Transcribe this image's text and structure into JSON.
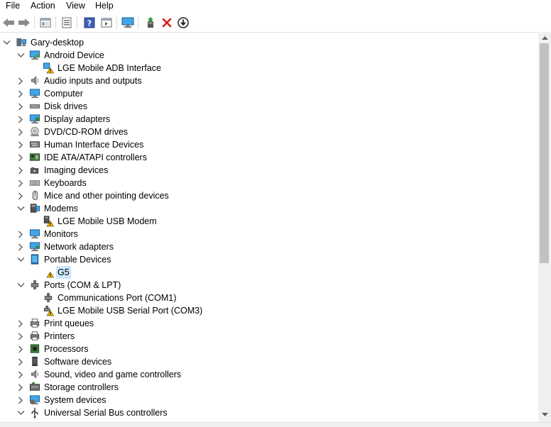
{
  "menu": [
    "File",
    "Action",
    "View",
    "Help"
  ],
  "toolbar": {
    "icons": [
      "back-arrow-icon",
      "forward-arrow-icon",
      "show-hide-tree-icon",
      "properties-icon",
      "help-icon",
      "action-pane-icon",
      "monitor-icon",
      "update-driver-icon",
      "uninstall-x-icon",
      "download-icon"
    ]
  },
  "tree": [
    {
      "label": "Gary-desktop",
      "level": 0,
      "state": "expanded",
      "icon": "computer-desktop-icon"
    },
    {
      "label": "Android Device",
      "level": 1,
      "state": "expanded",
      "icon": "android-device-icon"
    },
    {
      "label": "LGE Mobile ADB Interface",
      "level": 2,
      "state": "none",
      "icon": "warning-device-icon"
    },
    {
      "label": "Audio inputs and outputs",
      "level": 1,
      "state": "collapsed",
      "icon": "speaker-icon"
    },
    {
      "label": "Computer",
      "level": 1,
      "state": "collapsed",
      "icon": "computer-icon"
    },
    {
      "label": "Disk drives",
      "level": 1,
      "state": "collapsed",
      "icon": "disk-drive-icon"
    },
    {
      "label": "Display adapters",
      "level": 1,
      "state": "collapsed",
      "icon": "display-adapter-icon"
    },
    {
      "label": "DVD/CD-ROM drives",
      "level": 1,
      "state": "collapsed",
      "icon": "dvd-icon"
    },
    {
      "label": "Human Interface Devices",
      "level": 1,
      "state": "collapsed",
      "icon": "hid-icon"
    },
    {
      "label": "IDE ATA/ATAPI controllers",
      "level": 1,
      "state": "collapsed",
      "icon": "ide-controller-icon"
    },
    {
      "label": "Imaging devices",
      "level": 1,
      "state": "collapsed",
      "icon": "camera-icon"
    },
    {
      "label": "Keyboards",
      "level": 1,
      "state": "collapsed",
      "icon": "keyboard-icon"
    },
    {
      "label": "Mice and other pointing devices",
      "level": 1,
      "state": "collapsed",
      "icon": "mouse-icon"
    },
    {
      "label": "Modems",
      "level": 1,
      "state": "expanded",
      "icon": "modem-icon"
    },
    {
      "label": "LGE Mobile USB Modem",
      "level": 2,
      "state": "none",
      "icon": "warning-modem-icon"
    },
    {
      "label": "Monitors",
      "level": 1,
      "state": "collapsed",
      "icon": "monitor-icon"
    },
    {
      "label": "Network adapters",
      "level": 1,
      "state": "collapsed",
      "icon": "network-adapter-icon"
    },
    {
      "label": "Portable Devices",
      "level": 1,
      "state": "expanded",
      "icon": "portable-device-icon"
    },
    {
      "label": "G5",
      "level": 2,
      "state": "none",
      "icon": "warning-icon",
      "selected": true
    },
    {
      "label": "Ports (COM & LPT)",
      "level": 1,
      "state": "expanded",
      "icon": "port-icon"
    },
    {
      "label": "Communications Port (COM1)",
      "level": 2,
      "state": "none",
      "icon": "port-icon"
    },
    {
      "label": "LGE Mobile USB Serial Port (COM3)",
      "level": 2,
      "state": "none",
      "icon": "warning-port-icon"
    },
    {
      "label": "Print queues",
      "level": 1,
      "state": "collapsed",
      "icon": "print-queue-icon"
    },
    {
      "label": "Printers",
      "level": 1,
      "state": "collapsed",
      "icon": "printer-icon"
    },
    {
      "label": "Processors",
      "level": 1,
      "state": "collapsed",
      "icon": "processor-icon"
    },
    {
      "label": "Software devices",
      "level": 1,
      "state": "collapsed",
      "icon": "software-device-icon"
    },
    {
      "label": "Sound, video and game controllers",
      "level": 1,
      "state": "collapsed",
      "icon": "sound-icon"
    },
    {
      "label": "Storage controllers",
      "level": 1,
      "state": "collapsed",
      "icon": "storage-controller-icon"
    },
    {
      "label": "System devices",
      "level": 1,
      "state": "collapsed",
      "icon": "system-device-icon"
    },
    {
      "label": "Universal Serial Bus controllers",
      "level": 1,
      "state": "expanded",
      "icon": "usb-icon"
    }
  ],
  "colors": {
    "selection": "#cce8ff",
    "warning": "#f5c400",
    "chevron": "#555555",
    "accent": "#2e7bd6"
  }
}
